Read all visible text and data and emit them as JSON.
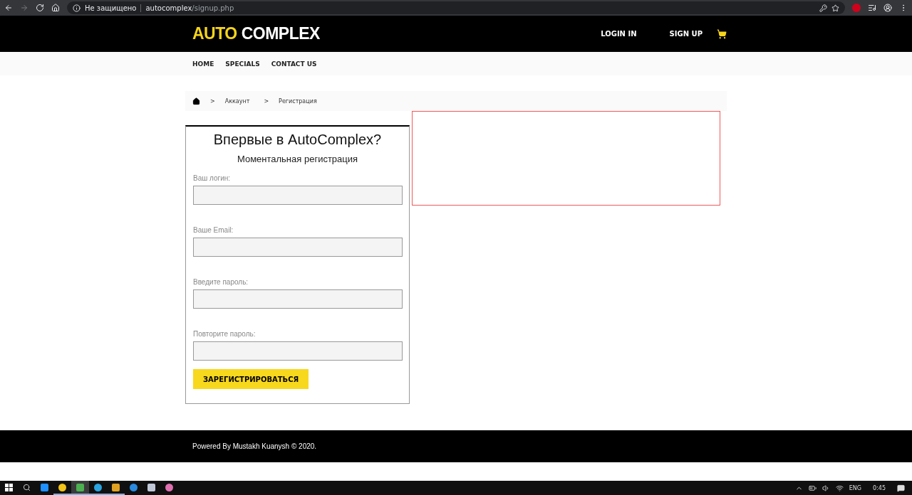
{
  "browser": {
    "security": "Не защищено",
    "url": {
      "host": "autocomplex",
      "path": "/signup.php"
    },
    "forward_disabled": true
  },
  "header": {
    "logo": {
      "accent": "AUTO",
      "rest": "COMPLEX"
    },
    "links": [
      "LOGIN IN",
      "SIGN UP"
    ]
  },
  "nav": [
    "HOME",
    "SPECIALS",
    "CONTACT US"
  ],
  "breadcrumb": [
    "Аккаунт",
    "Регистрация"
  ],
  "breadcrumb_separator": ">",
  "form": {
    "title": "Впервые в AutoComplex?",
    "subtitle": "Моментальная регистрация",
    "fields": [
      {
        "label": "Ваш логин:"
      },
      {
        "label": "Ваше Email:"
      },
      {
        "label": "Введите пароль:"
      },
      {
        "label": "Повторите пароль:"
      }
    ],
    "submit": "ЗАРЕГИСТРИРОВАТЬСЯ"
  },
  "footer": "Powered By Mustakh Kuanysh © 2020.",
  "taskbar": {
    "apps": [
      {
        "open": false,
        "selected": false
      },
      {
        "open": true,
        "selected": false
      },
      {
        "open": true,
        "selected": true
      },
      {
        "open": true,
        "selected": false
      },
      {
        "open": true,
        "selected": false
      },
      {
        "open": false,
        "selected": false
      },
      {
        "open": false,
        "selected": false
      },
      {
        "open": false,
        "selected": false
      }
    ],
    "language": "ENG",
    "time": "0:45"
  }
}
